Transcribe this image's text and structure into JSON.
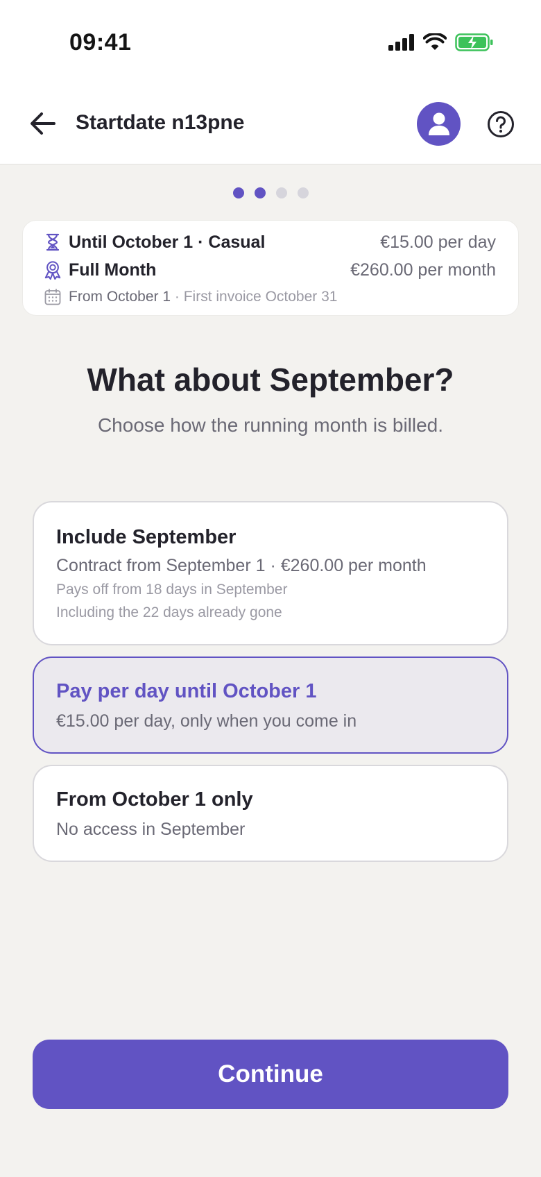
{
  "status_bar": {
    "time": "09:41"
  },
  "header": {
    "title": "Startdate n13pne"
  },
  "progress": {
    "total_steps": 4,
    "current_step": 2
  },
  "summary": {
    "rows": [
      {
        "icon": "hourglass-icon",
        "label": "Until October 1 · Casual",
        "value": "€15.00 per day"
      },
      {
        "icon": "award-ribbon-icon",
        "label": "Full Month",
        "value": "€260.00 per month"
      }
    ],
    "start": {
      "icon": "calendar-icon",
      "label": "From October 1",
      "detail": " · First invoice October 31"
    }
  },
  "question": {
    "title": "What about September?",
    "subtitle": "Choose how the running month is billed."
  },
  "options": [
    {
      "title": "Include September",
      "line": "Contract from September 1 · €260.00 per month",
      "notes": [
        "Pays off from 18 days in September",
        "Including the 22 days already gone"
      ],
      "selected": false
    },
    {
      "title": "Pay per day until October 1",
      "line": "€15.00 per day, only when you come in",
      "selected": true
    },
    {
      "title": "From October 1 only",
      "line": "No access in September",
      "selected": false
    }
  ],
  "actions": {
    "continue_label": "Continue"
  },
  "colors": {
    "accent": "#6153c3",
    "background": "#f3f2ef",
    "battery": "#3cc25a"
  }
}
